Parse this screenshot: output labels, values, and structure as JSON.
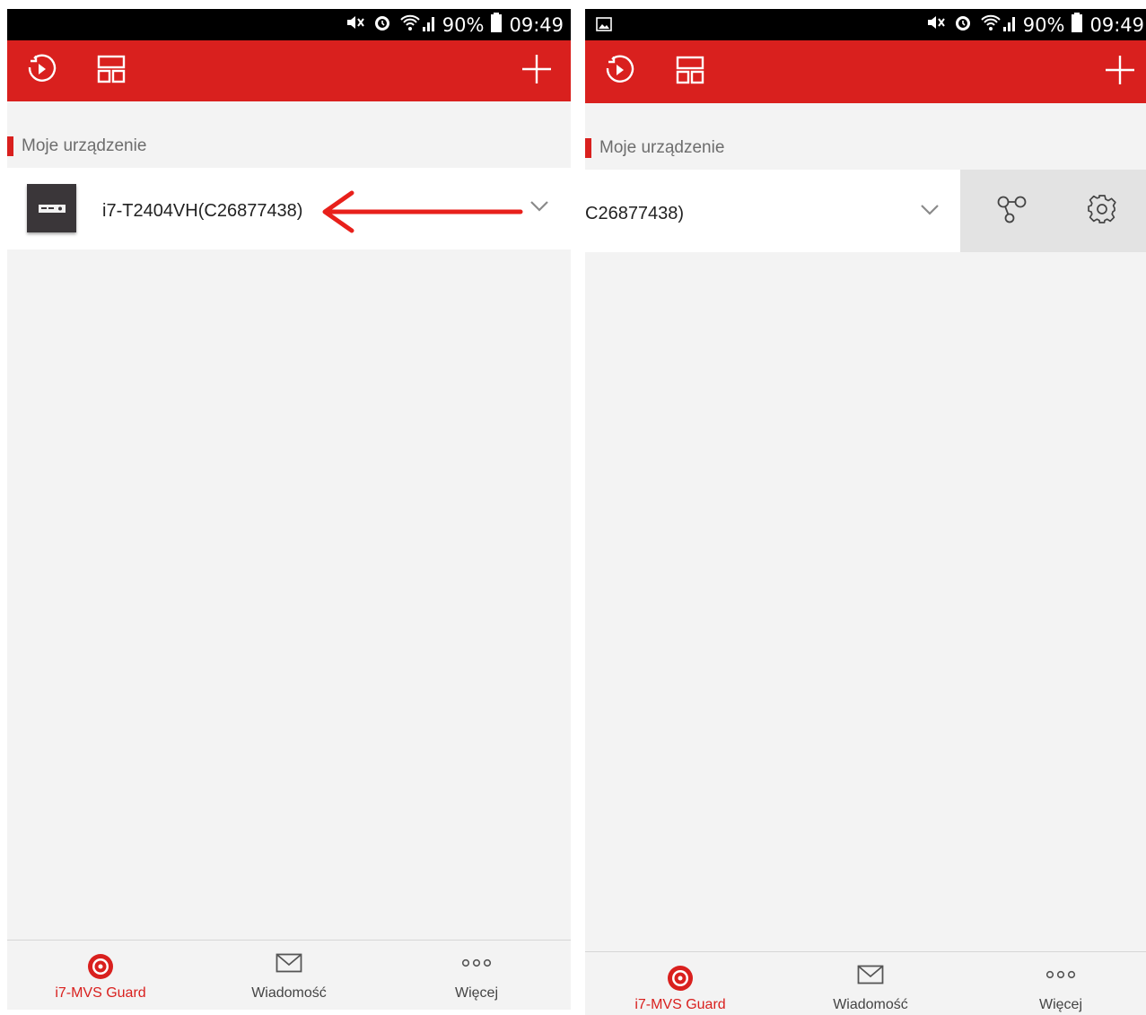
{
  "status": {
    "battery": "90%",
    "time": "09:49"
  },
  "section": {
    "title": "Moje urządzenie"
  },
  "device": {
    "name_full": "i7-T2404VH(C26877438)",
    "name_truncated": "C26877438)"
  },
  "nav": {
    "items": [
      {
        "label": "i7-MVS Guard",
        "icon": "guard-icon",
        "active": true
      },
      {
        "label": "Wiadomość",
        "icon": "envelope-icon",
        "active": false
      },
      {
        "label": "Więcej",
        "icon": "more-dots-icon",
        "active": false
      }
    ]
  },
  "colors": {
    "brand_red": "#d9201e",
    "background": "#f3f3f3",
    "annotation_arrow": "#e8201b"
  }
}
